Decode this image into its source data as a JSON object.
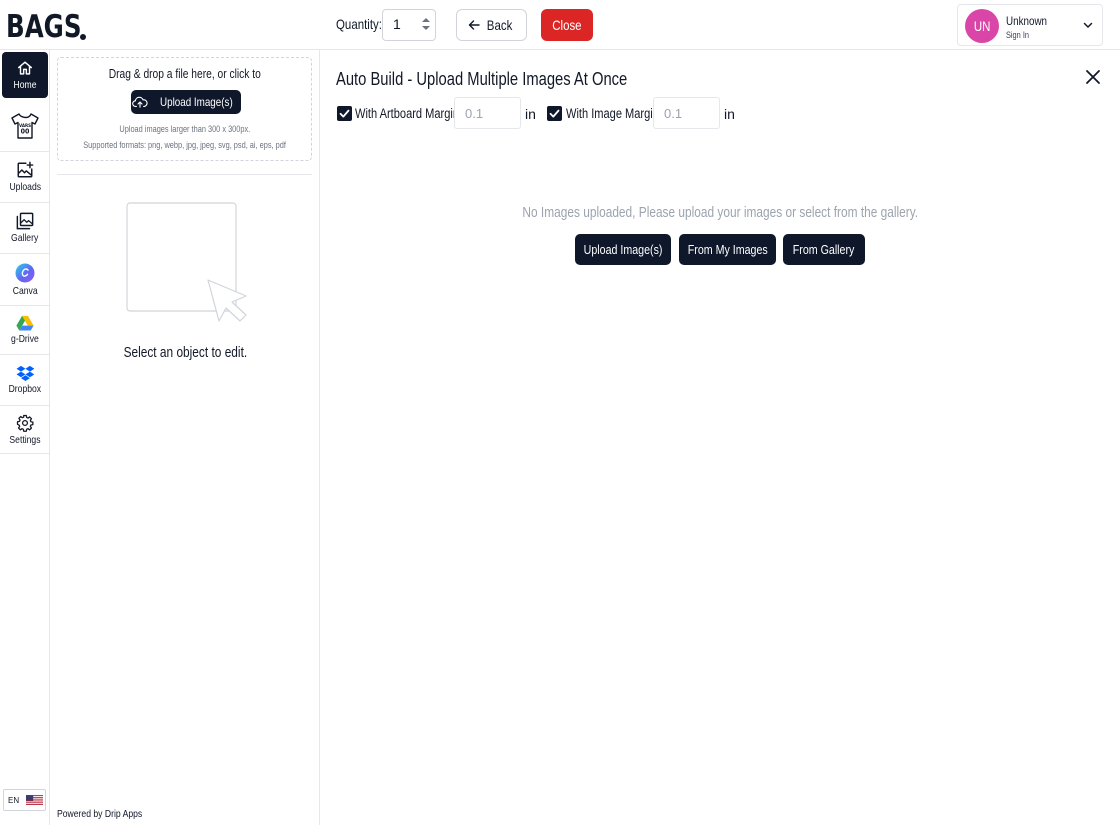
{
  "header": {
    "logo_text": "BAGS.",
    "quantity_label": "Quantity:",
    "quantity_value": "1",
    "back_label": "Back",
    "close_label": "Close",
    "user": {
      "initials": "UN",
      "name": "Unknown",
      "signin_label": "Sign In"
    }
  },
  "sidebar": {
    "items": [
      {
        "label": "Home",
        "icon": "home-icon",
        "active": true
      },
      {
        "label": "",
        "icon": "tshirt-icon",
        "active": false
      },
      {
        "label": "Uploads",
        "icon": "upload-image-icon",
        "active": false
      },
      {
        "label": "Gallery",
        "icon": "gallery-icon",
        "active": false
      },
      {
        "label": "Canva",
        "icon": "canva-icon",
        "active": false
      },
      {
        "label": "g-Drive",
        "icon": "gdrive-icon",
        "active": false
      },
      {
        "label": "Dropbox",
        "icon": "dropbox-icon",
        "active": false
      },
      {
        "label": "Settings",
        "icon": "gear-icon",
        "active": false
      }
    ],
    "language": "EN"
  },
  "upload_panel": {
    "dropzone_title": "Drag & drop a file here, or click to",
    "upload_button": "Upload Image(s)",
    "hint_size": "Upload images larger than 300 x 300px.",
    "hint_formats": "Supported formats: png, webp, jpg, jpeg, svg, psd, ai, eps, pdf",
    "select_message": "Select an object to edit.",
    "powered_by_prefix": "Powered by",
    "powered_by_brand": "Drip Apps"
  },
  "auto_build": {
    "title": "Auto Build - Upload Multiple Images At Once",
    "artboard_margin_label": "With Artboard Margin",
    "artboard_margin_checked": true,
    "artboard_margin_placeholder": "0.1",
    "image_margin_label": "With Image Margin",
    "image_margin_checked": true,
    "image_margin_placeholder": "0.1",
    "unit": "in",
    "empty_message": "No Images uploaded, Please upload your images or select from the gallery.",
    "buttons": {
      "upload": "Upload Image(s)",
      "my_images": "From My Images",
      "gallery": "From Gallery"
    }
  },
  "colors": {
    "primary": "#0f172a",
    "danger": "#dc2626",
    "avatar": "#d946a8",
    "muted_text": "#9ca3af"
  }
}
